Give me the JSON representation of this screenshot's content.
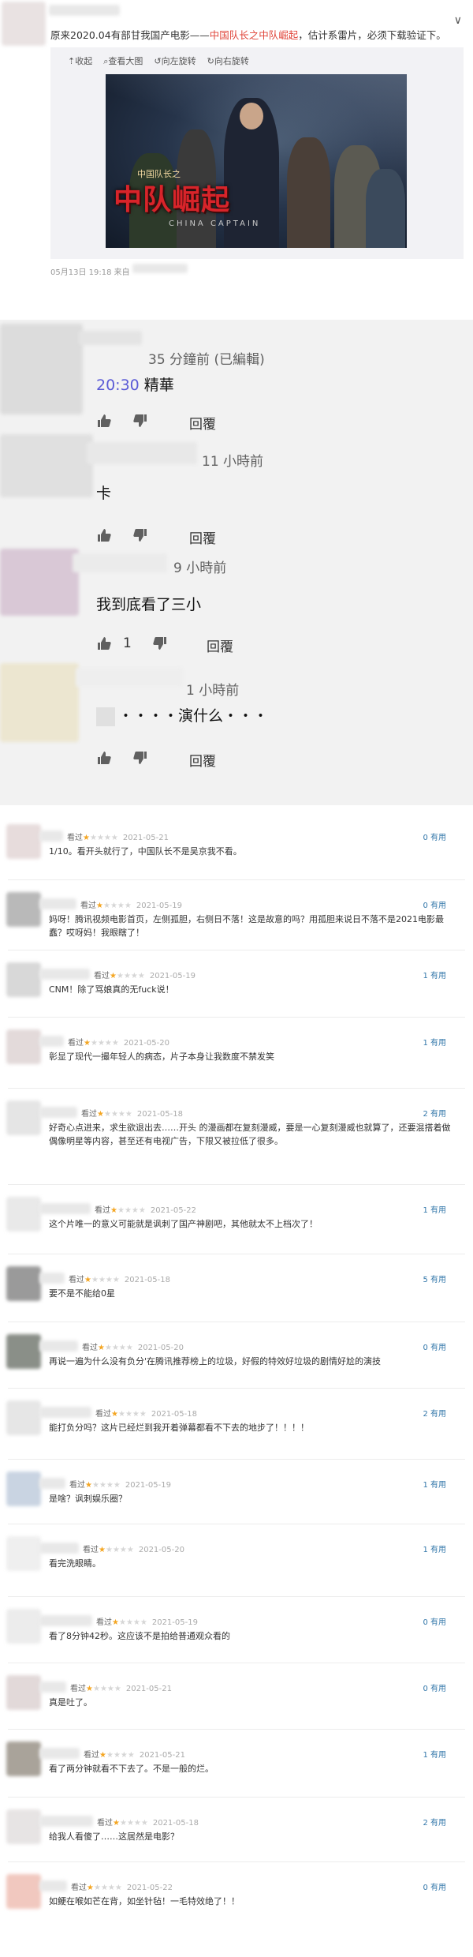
{
  "weibo": {
    "text_before": "原来2020.04有部甘我国产电影——",
    "text_highlight": "中国队长之中队崛起",
    "text_after": "，估计系雷片，必须下载验证下。",
    "tools": [
      "收起",
      "查看大图",
      "向左旋转",
      "向右旋转"
    ],
    "poster": {
      "small_title": "中国队长之",
      "big_title": "中队崛起",
      "english_title": "CHINA CAPTAIN"
    },
    "meta": "05月13日 19:18 来自"
  },
  "youtube_comments": [
    {
      "time": "35 分鐘前 (已編輯)",
      "timestamp_link": "20:30",
      "text": " 精華",
      "likes": "",
      "reply": "回覆"
    },
    {
      "time": "11 小時前",
      "timestamp_link": "",
      "text": "卡",
      "likes": "",
      "reply": "回覆"
    },
    {
      "time": "9 小時前",
      "timestamp_link": "",
      "text": "我到底看了三小",
      "likes": "1",
      "reply": "回覆"
    },
    {
      "time": "1 小時前",
      "timestamp_link": "",
      "text": "・・・・演什么・・・",
      "likes": "",
      "reply": "回覆"
    }
  ],
  "douban_reviews": [
    {
      "seen": "看过",
      "stars": 1,
      "date": "2021-05-21",
      "useful": "0 有用",
      "text": "1/10。看开头就行了，中国队长不是吴京我不看。"
    },
    {
      "seen": "看过",
      "stars": 1,
      "date": "2021-05-19",
      "useful": "0 有用",
      "text": "妈呀！腾讯视频电影首页，左侧孤胆，右侧日不落！这是故意的吗？用孤胆来说日不落不是2021电影最 蠢？哎呀妈！我眼瞎了！"
    },
    {
      "seen": "看过",
      "stars": 1,
      "date": "2021-05-19",
      "useful": "1 有用",
      "text": "CNM！除了骂娘真的无fuck说！"
    },
    {
      "seen": "看过",
      "stars": 1,
      "date": "2021-05-20",
      "useful": "1 有用",
      "text": "彰显了现代一撮年轻人的病态，片子本身让我数度不禁发笑"
    },
    {
      "seen": "看过",
      "stars": 1,
      "date": "2021-05-18",
      "useful": "2 有用",
      "text": "好奇心点进来，求生欲退出去……开头 的漫画都在复刻漫威，要是一心复刻漫威也就算了，还要混搭着做 偶像明星等内容，甚至还有电视广告，下限又被拉低了很多。"
    },
    {
      "seen": "看过",
      "stars": 1,
      "date": "2021-05-22",
      "useful": "1 有用",
      "text": "这个片唯一的意义可能就是讽刺了国产神剧吧，其他就太不上档次了！"
    },
    {
      "seen": "看过",
      "stars": 1,
      "date": "2021-05-18",
      "useful": "5 有用",
      "text": "要不是不能给0星"
    },
    {
      "seen": "看过",
      "stars": 1,
      "date": "2021-05-20",
      "useful": "0 有用",
      "text": "再说一遍为什么没有负分'在腾讯推荐榜上的垃圾，好假的特效好垃圾的剧情好尬的演技"
    },
    {
      "seen": "看过",
      "stars": 1,
      "date": "2021-05-18",
      "useful": "2 有用",
      "text": "能打负分吗？这片已经烂到我开着弹幕都看不下去的地步了！！！！"
    },
    {
      "seen": "看过",
      "stars": 1,
      "date": "2021-05-19",
      "useful": "1 有用",
      "text": "是啥？讽刺娱乐圈？"
    },
    {
      "seen": "看过",
      "stars": 1,
      "date": "2021-05-20",
      "useful": "1 有用",
      "text": "看完洗眼睛。"
    },
    {
      "seen": "看过",
      "stars": 1,
      "date": "2021-05-19",
      "useful": "0 有用",
      "text": "看了8分钟42秒。这应该不是拍给普通观众看的"
    },
    {
      "seen": "看过",
      "stars": 1,
      "date": "2021-05-21",
      "useful": "0 有用",
      "text": "真是吐了。"
    },
    {
      "seen": "看过",
      "stars": 1,
      "date": "2021-05-21",
      "useful": "1 有用",
      "text": "看了两分钟就看不下去了。不是一般的烂。"
    },
    {
      "seen": "看过",
      "stars": 1,
      "date": "2021-05-18",
      "useful": "2 有用",
      "text": "给我人看傻了……这居然是电影？"
    },
    {
      "seen": "看过",
      "stars": 1,
      "date": "2021-05-22",
      "useful": "0 有用",
      "text": "如鲠在喉如芒在背，如坐针毡！一毛特效绝了！！"
    }
  ],
  "colors": {
    "highlight": "#e0453a",
    "timestamp_link": "#5b5bd6",
    "useful": "#3377aa",
    "star_on": "#f4a623",
    "star_off": "#d6d6d6"
  }
}
